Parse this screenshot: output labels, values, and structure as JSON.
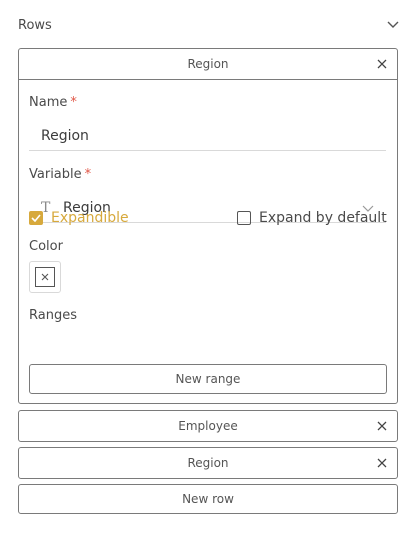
{
  "section": {
    "title": "Rows"
  },
  "expanded_row": {
    "header": "Region",
    "name_label": "Name",
    "name_value": "Region",
    "variable_label": "Variable",
    "variable_icon": "text-type-icon",
    "variable_icon_glyph": "T",
    "variable_value": "Region",
    "expandible_label": "Expandible",
    "expandible_checked": true,
    "expand_default_label": "Expand by default",
    "expand_default_checked": false,
    "color_label": "Color",
    "ranges_label": "Ranges",
    "new_range_label": "New range"
  },
  "collapsed_rows": [
    {
      "label": "Employee"
    },
    {
      "label": "Region"
    }
  ],
  "new_row_label": "New row",
  "colors": {
    "accent": "#d7a93c",
    "required": "#e05545",
    "border": "#7a7a7a",
    "divider": "#d9d9d9"
  }
}
